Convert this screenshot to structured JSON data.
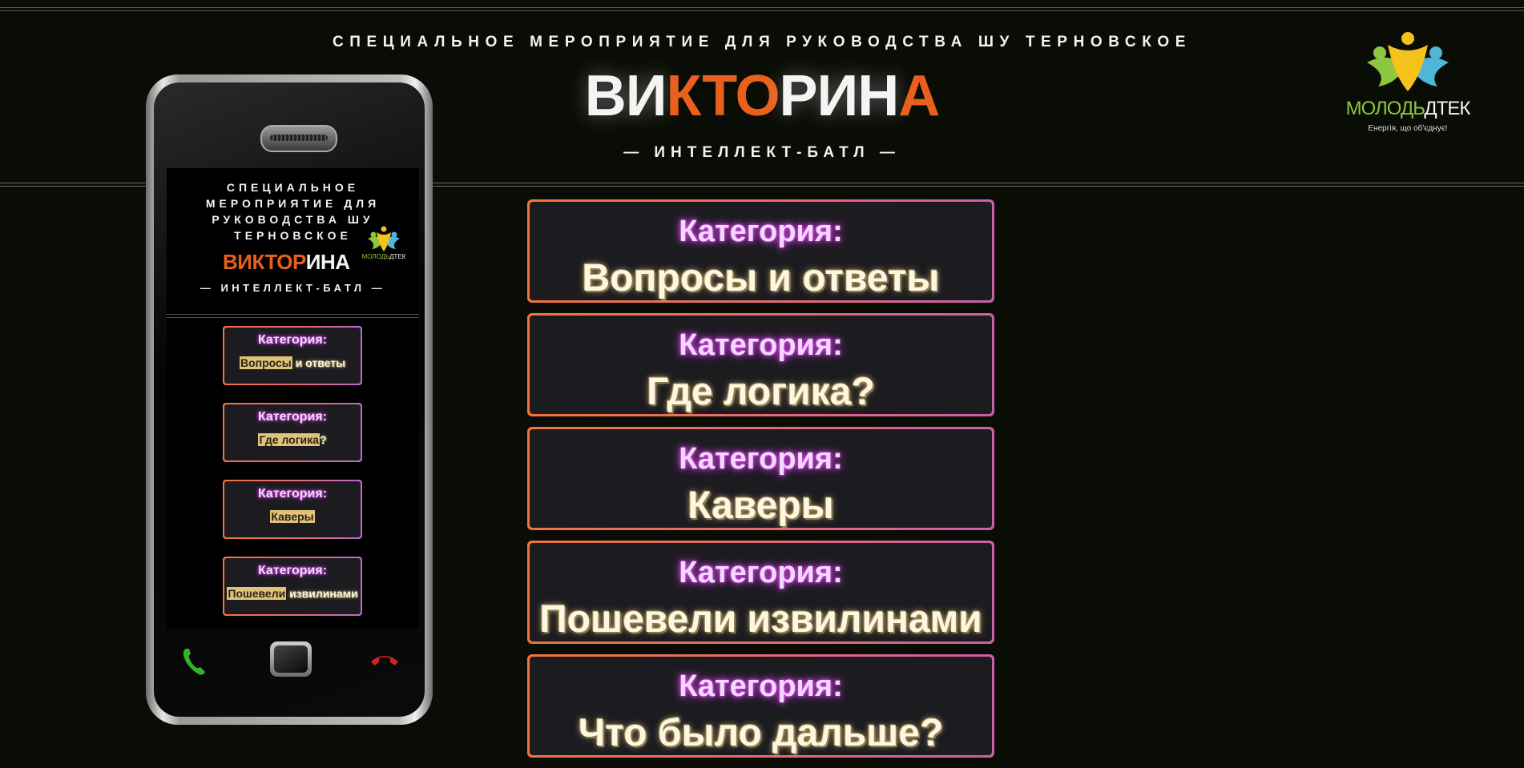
{
  "header": {
    "kicker": "СПЕЦИАЛЬНОЕ МЕРОПРИЯТИЕ ДЛЯ РУКОВОДСТВА ШУ ТЕРНОВСКОЕ",
    "title_parts": [
      "ВИ",
      "КТО",
      "РИН",
      "А"
    ],
    "subtitle": "— ИНТЕЛЛЕКТ-БАТЛ —"
  },
  "logo": {
    "word1": "МОЛОДЬ",
    "word2": "ДТЕК",
    "tagline": "Енергія, що об'єднує!",
    "icon": "people-logo-icon"
  },
  "categories": [
    {
      "label": "Категория:",
      "name": "Вопросы и ответы"
    },
    {
      "label": "Категория:",
      "name": "Где логика?"
    },
    {
      "label": "Категория:",
      "name": "Каверы"
    },
    {
      "label": "Категория:",
      "name": "Пошевели извилинами"
    },
    {
      "label": "Категория:",
      "name": "Что было дальше?"
    }
  ],
  "phone_preview": {
    "kicker": "СПЕЦИАЛЬНОЕ МЕРОПРИЯТИЕ ДЛЯ РУКОВОДСТВА ШУ ТЕРНОВСКОЕ",
    "title_orange": "ВИКТОР",
    "title_white": "ИНА",
    "subtitle": "— ИНТЕЛЛЕКТ-БАТЛ —",
    "cards": [
      {
        "label": "Категория:",
        "hl": "Вопросы",
        "rest": " и ответы"
      },
      {
        "label": "Категория:",
        "hl": "Где логика",
        "rest": "?"
      },
      {
        "label": "Категория:",
        "hl": "Каверы",
        "rest": ""
      },
      {
        "label": "Категория:",
        "hl": "Пошевели",
        "rest": " извилинами"
      }
    ]
  },
  "colors": {
    "background": "#0a0d06",
    "accent_orange": "#e8601c",
    "card_border": "#f0743a",
    "label_glow": "#d94ee6",
    "value_text": "#fff6e0"
  },
  "icons": [
    "call-icon",
    "home-button-icon",
    "end-call-icon",
    "people-logo-icon"
  ]
}
